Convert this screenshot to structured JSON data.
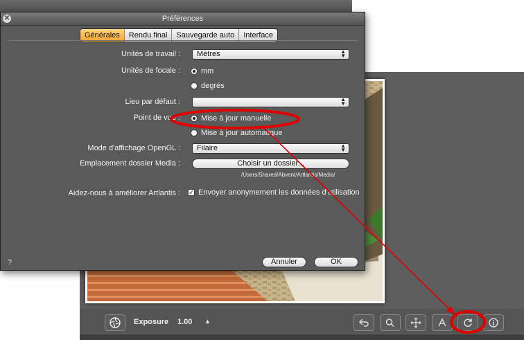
{
  "dialog": {
    "title": "Préférences",
    "close_icon": "close-icon",
    "tabs": [
      {
        "label": "Générales",
        "active": true
      },
      {
        "label": "Rendu final",
        "active": false
      },
      {
        "label": "Sauvegarde auto",
        "active": false
      },
      {
        "label": "Interface",
        "active": false
      }
    ],
    "work_units": {
      "label": "Unités de travail :",
      "value": "Mètres"
    },
    "focal_units": {
      "label": "Unités de focale :",
      "options": [
        "mm",
        "degrés"
      ],
      "selected": "mm"
    },
    "default_location": {
      "label": "Lieu par défaut :",
      "value": ""
    },
    "viewpoint": {
      "label": "Point de vue :",
      "options": [
        "Mise à jour manuelle",
        "Mise à jour automatique"
      ],
      "selected": "Mise à jour manuelle"
    },
    "opengl_mode": {
      "label": "Mode d'affichage OpenGL :",
      "value": "Filaire"
    },
    "media_folder": {
      "label": "Emplacement dossier Media :",
      "button": "Choisir un dossier...",
      "path": "/Users/Shared/Abvent/Artlantis/Media/"
    },
    "improve": {
      "label": "Aidez-nous à améliorer Artlantis :",
      "checkbox": "Envoyer anonymement les données d'utilisation",
      "checked": true
    },
    "help": "?",
    "cancel": "Annuler",
    "ok": "OK"
  },
  "bottom_bar": {
    "exposure_label": "Exposure",
    "exposure_value": "1.00",
    "tools": [
      "undo-icon",
      "zoom-icon",
      "pan-icon",
      "walk-icon",
      "refresh-icon",
      "info-icon"
    ]
  },
  "colors": {
    "active_tab": "#f2a531",
    "annotation": "#e00000",
    "dialog_bg": "#5a5a5a"
  }
}
